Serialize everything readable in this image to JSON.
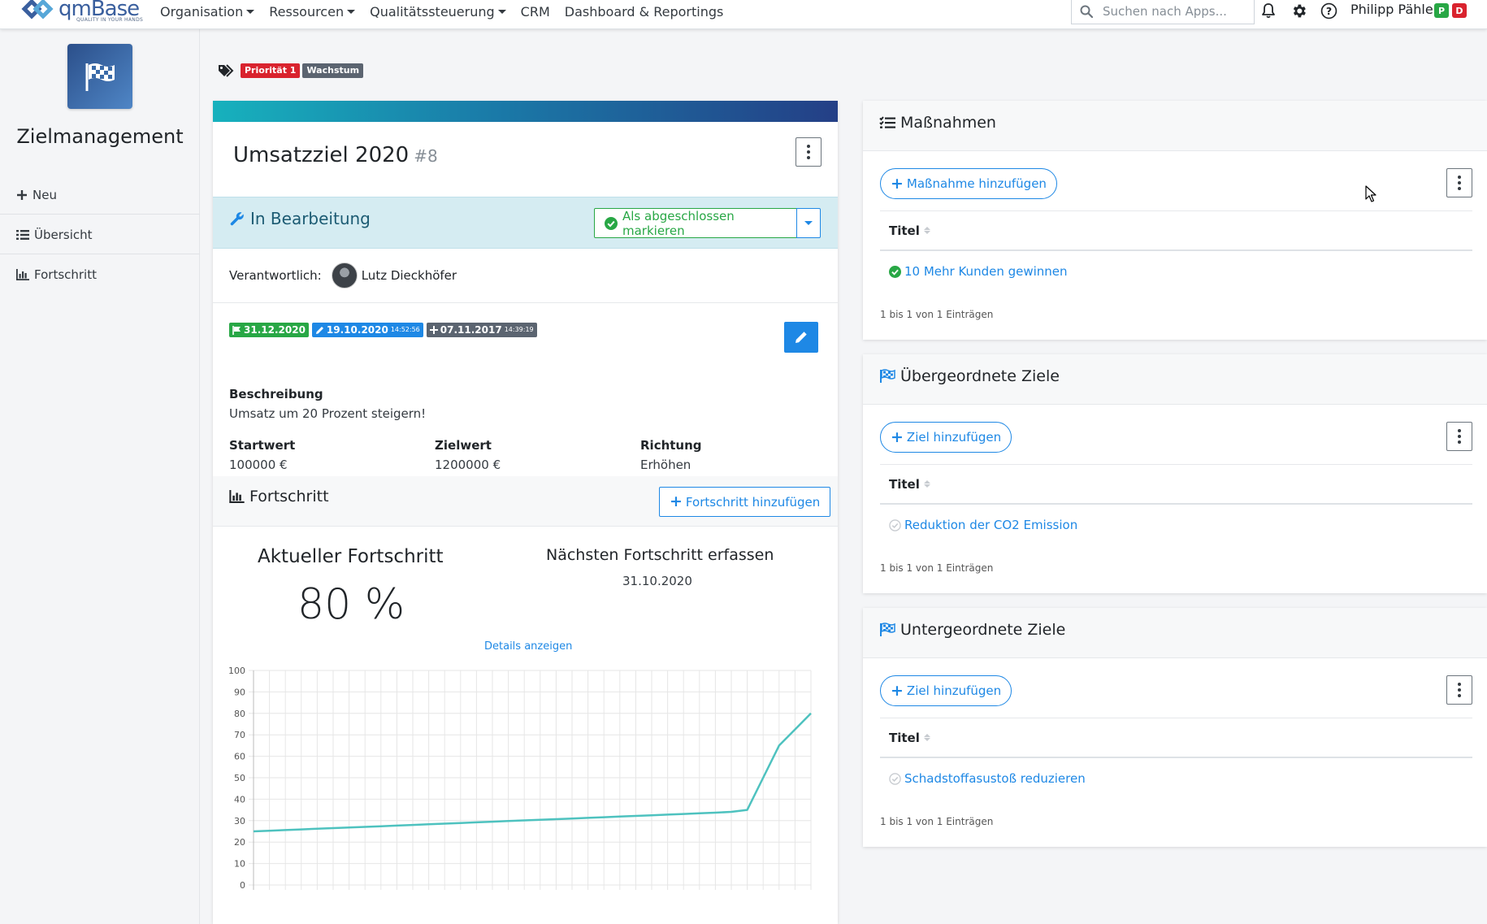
{
  "brand": {
    "name": "qmBase",
    "tagline": "QUALITY IN YOUR HANDS"
  },
  "nav": {
    "items": [
      {
        "label": "Organisation",
        "dropdown": true
      },
      {
        "label": "Ressourcen",
        "dropdown": true
      },
      {
        "label": "Qualitätssteuerung",
        "dropdown": true
      },
      {
        "label": "CRM",
        "dropdown": false
      },
      {
        "label": "Dashboard & Reportings",
        "dropdown": false
      }
    ],
    "search_placeholder": "Suchen nach Apps...",
    "user": {
      "name": "Philipp Pähler",
      "badges": [
        "P",
        "D"
      ]
    },
    "icons": [
      "bell-icon",
      "gear-icon",
      "help-icon"
    ]
  },
  "sidebar": {
    "app_title": "Zielmanagement",
    "items": [
      {
        "label": "Neu",
        "icon": "plus-icon"
      },
      {
        "label": "Übersicht",
        "icon": "list-icon"
      },
      {
        "label": "Fortschritt",
        "icon": "bar-chart-icon"
      }
    ]
  },
  "tags": [
    {
      "label": "Priorität 1",
      "color": "#d9232e"
    },
    {
      "label": "Wachstum",
      "color": "#5b6470"
    }
  ],
  "goal": {
    "title": "Umsatzziel 2020",
    "number": "#8",
    "status": "In Bearbeitung",
    "complete_label": "Als abgeschlossen markieren",
    "responsible_label": "Verantwortlich:",
    "responsible_name": "Lutz Dieckhöfer",
    "dates": {
      "due": "31.12.2020",
      "edited": "19.10.2020",
      "edited_time": "14:52:56",
      "created": "07.11.2017",
      "created_time": "14:39:19"
    },
    "description_label": "Beschreibung",
    "description": "Umsatz um 20 Prozent steigern!",
    "fields": [
      {
        "label": "Startwert",
        "value": "100000 €"
      },
      {
        "label": "Zielwert",
        "value": "1200000 €"
      },
      {
        "label": "Richtung",
        "value": "Erhöhen"
      }
    ]
  },
  "progress": {
    "title": "Fortschritt",
    "add_label": "Fortschritt hinzufügen",
    "current_label": "Aktueller Fortschritt",
    "current_value": "80 %",
    "next_label": "Nächsten Fortschritt erfassen",
    "next_date": "31.10.2020",
    "details_link": "Details anzeigen"
  },
  "chart_data": {
    "type": "line",
    "ylim": [
      0,
      100
    ],
    "yticks": [
      0,
      10,
      20,
      30,
      40,
      50,
      60,
      70,
      80,
      90,
      100
    ],
    "x_count": 36,
    "values": [
      25,
      25.3,
      25.6,
      25.9,
      26.2,
      26.5,
      26.8,
      27.1,
      27.4,
      27.7,
      28,
      28.3,
      28.6,
      28.9,
      29.2,
      29.5,
      29.8,
      30.1,
      30.4,
      30.7,
      31,
      31.3,
      31.6,
      31.9,
      32.2,
      32.5,
      32.8,
      33.1,
      33.4,
      33.7,
      34.1,
      35,
      50,
      65,
      72.5,
      80
    ],
    "color": "#4ec2bf",
    "grid": true
  },
  "panels": [
    {
      "title": "Maßnahmen",
      "icon": "tasks-icon",
      "add_label": "Maßnahme hinzufügen",
      "column": "Titel",
      "rows": [
        {
          "label": "10 Mehr Kunden gewinnen",
          "done": true
        }
      ],
      "info": "1 bis 1 von 1 Einträgen"
    },
    {
      "title": "Übergeordnete Ziele",
      "icon": "flag-icon",
      "add_label": "Ziel hinzufügen",
      "column": "Titel",
      "rows": [
        {
          "label": "Reduktion der CO2 Emission",
          "done": false
        }
      ],
      "info": "1 bis 1 von 1 Einträgen"
    },
    {
      "title": "Untergeordnete Ziele",
      "icon": "flag-icon",
      "add_label": "Ziel hinzufügen",
      "column": "Titel",
      "rows": [
        {
          "label": "Schadstoffasustoß reduzieren",
          "done": false
        }
      ],
      "info": "1 bis 1 von 1 Einträgen"
    }
  ],
  "colors": {
    "primary": "#1e88e5",
    "success": "#28a745",
    "status_bg": "#d5ecf2"
  }
}
